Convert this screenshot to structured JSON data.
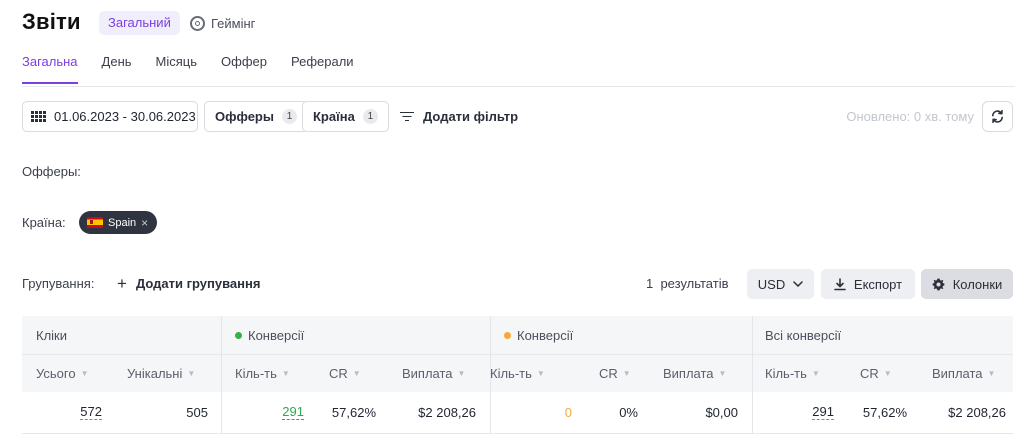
{
  "header": {
    "title": "Звіти",
    "report_types": [
      {
        "label": "Загальний",
        "active": true
      },
      {
        "label": "Геймінг",
        "active": false,
        "icon": "target-icon"
      }
    ]
  },
  "nav": {
    "tabs": [
      {
        "label": "Загальна",
        "active": true
      },
      {
        "label": "День",
        "active": false
      },
      {
        "label": "Місяць",
        "active": false
      },
      {
        "label": "Оффер",
        "active": false
      },
      {
        "label": "Реферали",
        "active": false
      }
    ]
  },
  "filters": {
    "date_range": "01.06.2023 - 30.06.2023",
    "offers_label": "Офферы",
    "offers_count": "1",
    "country_label": "Країна",
    "country_count": "1",
    "add_filter": "Додати фільтр",
    "updated": "Оновлено: 0 хв. тому"
  },
  "active_filters": {
    "offers_label": "Офферы:",
    "country_label": "Країна:",
    "country_chip": "Spain",
    "chip_remove": "×"
  },
  "grouping": {
    "label": "Групування:",
    "add": "Додати групування",
    "results": "1  результатів",
    "currency": "USD",
    "export": "Експорт",
    "columns": "Колонки"
  },
  "table": {
    "groups": [
      {
        "label": "Кліки",
        "dot": null
      },
      {
        "label": "Конверсії",
        "dot": "#2fb344"
      },
      {
        "label": "Конверсії",
        "dot": "#f4a93a"
      },
      {
        "label": "Всі конверсії",
        "dot": null
      }
    ],
    "headers": [
      "Усього",
      "Унікальні",
      "Кіль-ть",
      "CR",
      "Виплата",
      "Кіль-ть",
      "CR",
      "Виплата",
      "Кіль-ть",
      "CR",
      "Виплата"
    ],
    "row": [
      "572",
      "505",
      "291",
      "57,62%",
      "$2 208,26",
      "0",
      "0%",
      "$0,00",
      "291",
      "57,62%",
      "$2 208,26"
    ],
    "colors": {
      "approved": "#2fa84f",
      "pending": "#f4a93a",
      "accent": "#7b3fe4"
    }
  }
}
